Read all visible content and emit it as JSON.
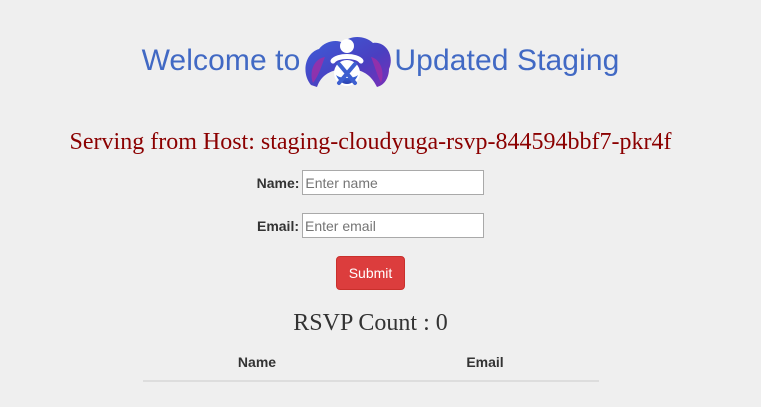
{
  "header": {
    "prefix": "Welcome to",
    "suffix": "Updated Staging",
    "logo_icon": "cloudyuga-logo-icon",
    "color": "#4169c4"
  },
  "host": {
    "text": "Serving from Host: staging-cloudyuga-rsvp-844594bbf7-pkr4f",
    "color": "#8b0000"
  },
  "form": {
    "name_label": "Name:",
    "name_placeholder": "Enter name",
    "name_value": "",
    "email_label": "Email:",
    "email_placeholder": "Enter email",
    "email_value": "",
    "submit_label": "Submit",
    "submit_color": "#dc3d3d"
  },
  "rsvp": {
    "count_text": "RSVP Count : 0",
    "columns": [
      "Name",
      "Email"
    ],
    "rows": []
  }
}
